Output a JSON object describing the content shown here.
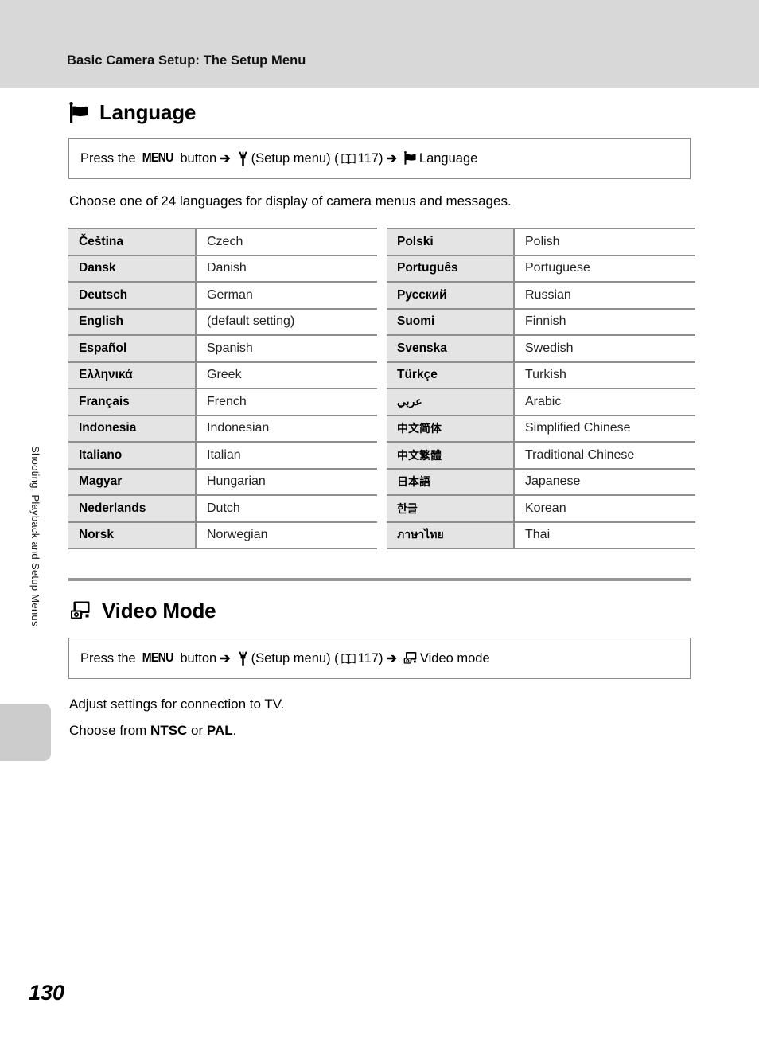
{
  "header": {
    "running_title": "Basic Camera Setup: The Setup Menu"
  },
  "side_tab": {
    "vertical_label": "Shooting, Playback and Setup Menus"
  },
  "page_number": "130",
  "sections": [
    {
      "id": "language",
      "icon": "flag-icon",
      "title": "Language",
      "command": {
        "press_the": "Press the",
        "menu_key": "MENU",
        "button_word": "button",
        "arrow": "➔",
        "wrench_icon": "wrench-icon",
        "setup_menu": "(Setup menu)",
        "ref_open": "(",
        "book_icon": "book-icon",
        "ref_page": "117",
        "ref_close": ")",
        "target_icon": "flag-icon",
        "target_label": "Language"
      },
      "description": "Choose one of 24 languages for display of camera menus and messages.",
      "table_left": [
        {
          "native": "Čeština",
          "english": "Czech"
        },
        {
          "native": "Dansk",
          "english": "Danish"
        },
        {
          "native": "Deutsch",
          "english": "German"
        },
        {
          "native": "English",
          "english": "(default setting)"
        },
        {
          "native": "Español",
          "english": "Spanish"
        },
        {
          "native": "Ελληνικά",
          "english": "Greek"
        },
        {
          "native": "Français",
          "english": "French"
        },
        {
          "native": "Indonesia",
          "english": "Indonesian"
        },
        {
          "native": "Italiano",
          "english": "Italian"
        },
        {
          "native": "Magyar",
          "english": "Hungarian"
        },
        {
          "native": "Nederlands",
          "english": "Dutch"
        },
        {
          "native": "Norsk",
          "english": "Norwegian"
        }
      ],
      "table_right": [
        {
          "native": "Polski",
          "english": "Polish"
        },
        {
          "native": "Português",
          "english": "Portuguese"
        },
        {
          "native": "Русский",
          "english": "Russian"
        },
        {
          "native": "Suomi",
          "english": "Finnish"
        },
        {
          "native": "Svenska",
          "english": "Swedish"
        },
        {
          "native": "Türkçe",
          "english": "Turkish"
        },
        {
          "native": "عربي",
          "english": "Arabic"
        },
        {
          "native": "中文简体",
          "english": "Simplified Chinese"
        },
        {
          "native": "中文繁體",
          "english": "Traditional Chinese"
        },
        {
          "native": "日本語",
          "english": "Japanese"
        },
        {
          "native": "한글",
          "english": "Korean"
        },
        {
          "native": "ภาษาไทย",
          "english": "Thai"
        }
      ]
    },
    {
      "id": "video-mode",
      "icon": "video-mode-icon",
      "title": "Video Mode",
      "command": {
        "press_the": "Press the",
        "menu_key": "MENU",
        "button_word": "button",
        "arrow": "➔",
        "wrench_icon": "wrench-icon",
        "setup_menu": "(Setup menu)",
        "ref_open": "(",
        "book_icon": "book-icon",
        "ref_page": "117",
        "ref_close": ")",
        "target_icon": "video-mode-icon",
        "target_label": "Video mode"
      },
      "description_line1": "Adjust settings for connection to TV.",
      "description_line2_prefix": "Choose from ",
      "option_ntsc": "NTSC",
      "description_line2_mid": " or ",
      "option_pal": "PAL",
      "description_line2_suffix": "."
    }
  ],
  "colors": {
    "header_bg": "#d8d8d8",
    "table_native_bg": "#e4e4e4",
    "rule": "#969696",
    "border": "#8f8f8f",
    "tab": "#cccccc"
  }
}
